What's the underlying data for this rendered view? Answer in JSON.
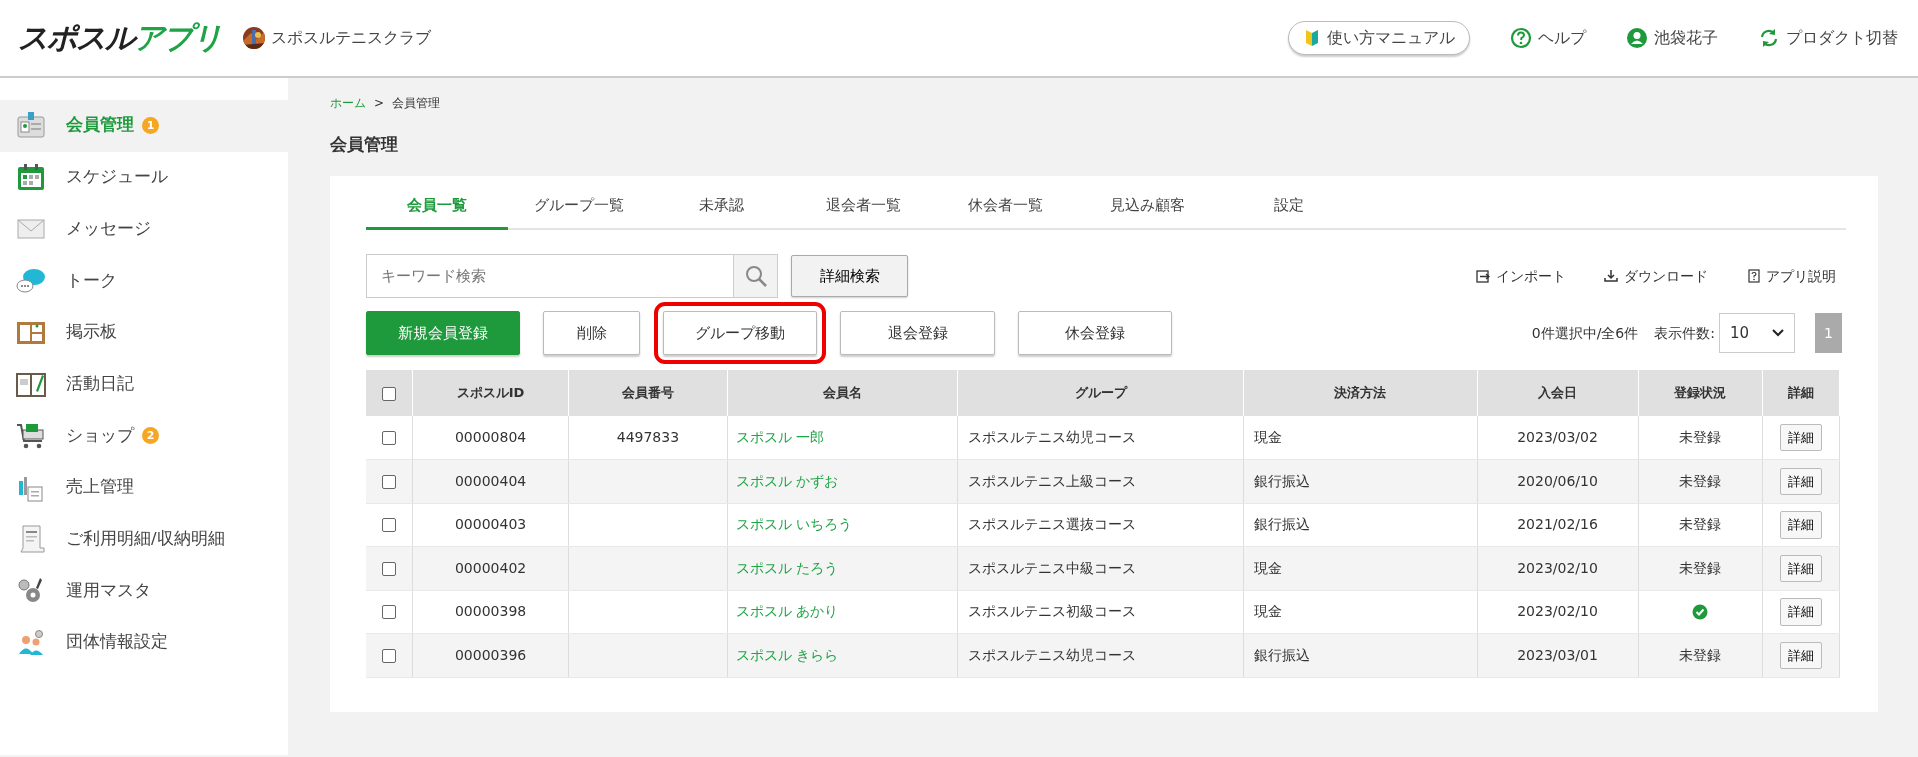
{
  "header": {
    "logo": {
      "word_1": "スポスル",
      "word_2": "アプリ"
    },
    "club_name": "スポスルテニスクラブ",
    "links": [
      {
        "kind": "manual",
        "label": "使い方マニュアル"
      },
      {
        "kind": "help",
        "label": "ヘルプ"
      },
      {
        "kind": "user",
        "label": "池袋花子"
      },
      {
        "kind": "switch",
        "label": "プロダクト切替"
      }
    ]
  },
  "sidebar": {
    "items": [
      {
        "label": "会員管理",
        "selected": true,
        "badge": "1"
      },
      {
        "label": "スケジュール",
        "selected": false
      },
      {
        "label": "メッセージ",
        "selected": false
      },
      {
        "label": "トーク",
        "selected": false
      },
      {
        "label": "掲示板",
        "selected": false
      },
      {
        "label": "活動日記",
        "selected": false
      },
      {
        "label": "ショップ",
        "selected": false,
        "badge": "2"
      },
      {
        "label": "売上管理",
        "selected": false
      },
      {
        "label": "ご利用明細/収納明細",
        "selected": false
      },
      {
        "label": "運用マスタ",
        "selected": false
      },
      {
        "label": "団体情報設定",
        "selected": false
      }
    ]
  },
  "breadcrumb": {
    "items": [
      "ホーム",
      "会員管理"
    ],
    "separator": ">"
  },
  "page_title": "会員管理",
  "tabs": [
    {
      "label": "会員一覧",
      "selected": true
    },
    {
      "label": "グループ一覧",
      "selected": false
    },
    {
      "label": "未承認",
      "selected": false
    },
    {
      "label": "退会者一覧",
      "selected": false
    },
    {
      "label": "休会者一覧",
      "selected": false
    },
    {
      "label": "見込み顧客",
      "selected": false
    },
    {
      "label": "設定",
      "selected": false
    }
  ],
  "search": {
    "placeholder": "キーワード検索",
    "detail_button": "詳細検索"
  },
  "tools": [
    {
      "kind": "import",
      "label": "インポート"
    },
    {
      "kind": "download",
      "label": "ダウンロード"
    },
    {
      "kind": "help",
      "label": "アプリ説明"
    }
  ],
  "actions": [
    {
      "label": "新規会員登録",
      "kind": "primary",
      "highlighted": false
    },
    {
      "label": "削除",
      "kind": "default",
      "highlighted": false
    },
    {
      "label": "グループ移動",
      "kind": "default",
      "highlighted": true
    },
    {
      "label": "退会登録",
      "kind": "default",
      "highlighted": false
    },
    {
      "label": "休会登録",
      "kind": "default",
      "highlighted": false
    }
  ],
  "selection_count": "0件選択中/全6件",
  "page_size": {
    "label": "表示件数:",
    "value": "10"
  },
  "pagination": [
    {
      "label": "1",
      "selected": true
    }
  ],
  "table": {
    "header_checked": false,
    "columns": [
      "スポスルID",
      "会員番号",
      "会員名",
      "グループ",
      "決済方法",
      "入会日",
      "登録状況",
      "詳細"
    ],
    "rows": [
      {
        "checked": false,
        "id": "00000804",
        "member_no": "4497833",
        "name": "スポスル 一郎",
        "group": "スポスルテニス幼児コース",
        "payment": "現金",
        "joined": "2023/03/02",
        "registered": false,
        "status": "未登録",
        "detail": "詳細"
      },
      {
        "checked": false,
        "id": "00000404",
        "name": "スポスル かずお",
        "group": "スポスルテニス上級コース",
        "payment": "銀行振込",
        "joined": "2020/06/10",
        "registered": false,
        "status": "未登録",
        "detail": "詳細"
      },
      {
        "checked": false,
        "id": "00000403",
        "name": "スポスル いちろう",
        "group": "スポスルテニス選抜コース",
        "payment": "銀行振込",
        "joined": "2021/02/16",
        "registered": false,
        "status": "未登録",
        "detail": "詳細"
      },
      {
        "checked": false,
        "id": "00000402",
        "name": "スポスル たろう",
        "group": "スポスルテニス中級コース",
        "payment": "現金",
        "joined": "2023/02/10",
        "registered": false,
        "status": "未登録",
        "detail": "詳細"
      },
      {
        "checked": false,
        "id": "00000398",
        "name": "スポスル あかり",
        "group": "スポスルテニス初級コース",
        "payment": "現金",
        "joined": "2023/02/10",
        "registered": true,
        "detail": "詳細"
      },
      {
        "checked": false,
        "id": "00000396",
        "name": "スポスル きらら",
        "group": "スポスルテニス幼児コース",
        "payment": "銀行振込",
        "joined": "2023/03/01",
        "registered": false,
        "status": "未登録",
        "detail": "詳細"
      }
    ]
  }
}
